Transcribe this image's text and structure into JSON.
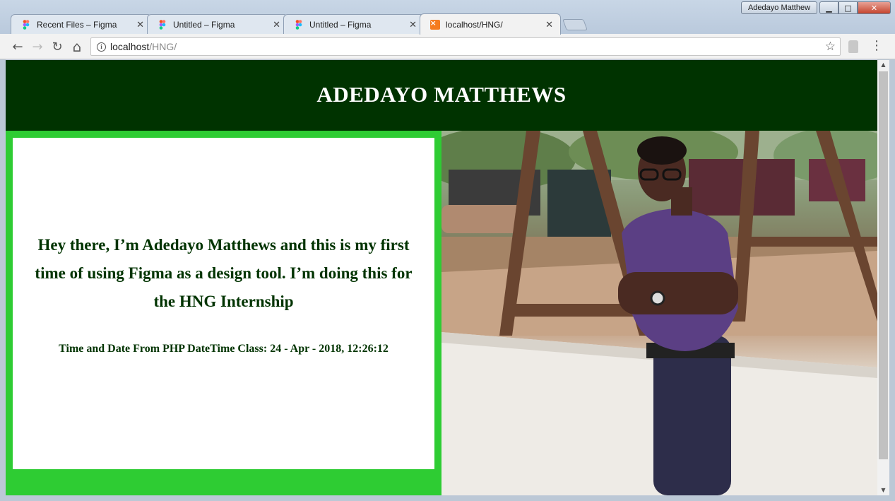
{
  "window": {
    "profile_name": "Adedayo Matthew",
    "controls": {
      "minimize": "▁",
      "maximize": "□",
      "close": "✕"
    }
  },
  "tabs": [
    {
      "label": "Recent Files – Figma",
      "icon": "figma-icon",
      "active": false
    },
    {
      "label": "Untitled – Figma",
      "icon": "figma-icon",
      "active": false
    },
    {
      "label": "Untitled – Figma",
      "icon": "figma-icon",
      "active": false
    },
    {
      "label": "localhost/HNG/",
      "icon": "xampp-icon",
      "active": true
    }
  ],
  "tab_close_glyph": "✕",
  "toolbar": {
    "back": "←",
    "forward": "→",
    "reload": "↻",
    "home": "⌂",
    "star": "☆",
    "menu": "⋮"
  },
  "address": {
    "host": "localhost",
    "path": "/HNG/"
  },
  "page": {
    "header_title": "ADEDAYO MATTHEWS",
    "intro_text": "Hey there, I’m Adedayo Matthews and this is my first time of using Figma as a design tool. I’m doing this for the HNG Internship",
    "datetime_text": "Time and Date From PHP DateTime Class: 24 - Apr - 2018, 12:26:12",
    "colors": {
      "header_bg": "#003300",
      "panel_bg": "#2ecc33",
      "text_dark_green": "#003300"
    }
  },
  "scrollbar": {
    "up": "▲",
    "down": "▼"
  }
}
